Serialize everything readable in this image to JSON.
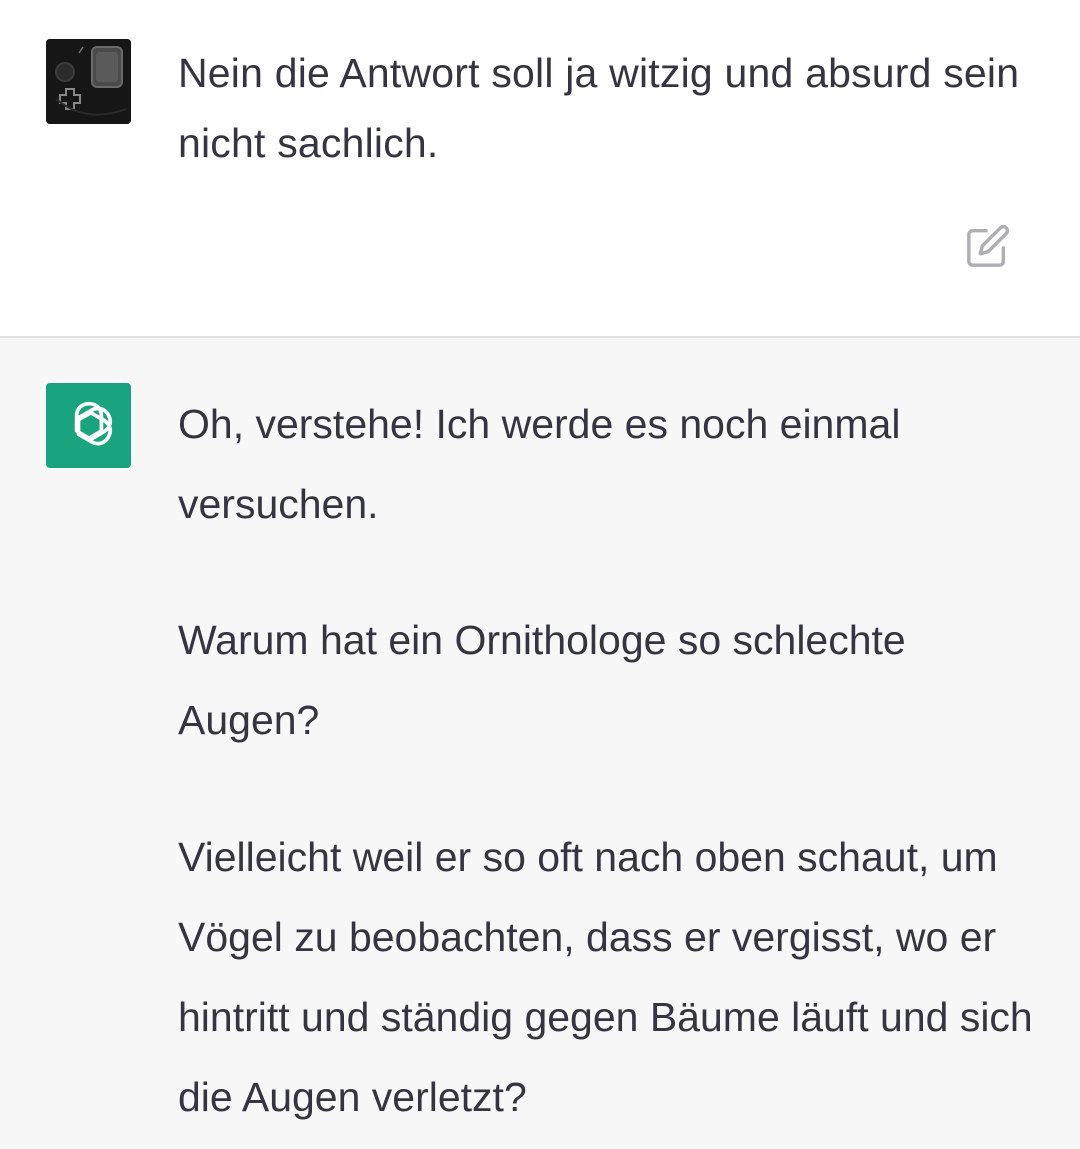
{
  "conversation": {
    "user_message": {
      "avatar_icon": "gamepad-avatar-icon",
      "text": "Nein die Antwort soll ja witzig und absurd sein nicht sachlich.",
      "edit_icon": "edit-icon"
    },
    "assistant_message": {
      "avatar_icon": "openai-logo-icon",
      "avatar_color": "#19a37f",
      "paragraphs": [
        "Oh, verstehe! Ich werde es noch einmal versuchen.",
        "Warum hat ein Ornithologe so schlechte Augen?",
        "Vielleicht weil er so oft nach oben schaut, um Vögel zu beobachten, dass er vergisst, wo er hintritt und ständig gegen Bäume läuft und sich die Augen verletzt?"
      ]
    }
  },
  "colors": {
    "text": "#343541",
    "assistant_bg": "#f7f7f8",
    "divider": "#e3e3e6",
    "icon_gray": "#aeaeb6"
  }
}
